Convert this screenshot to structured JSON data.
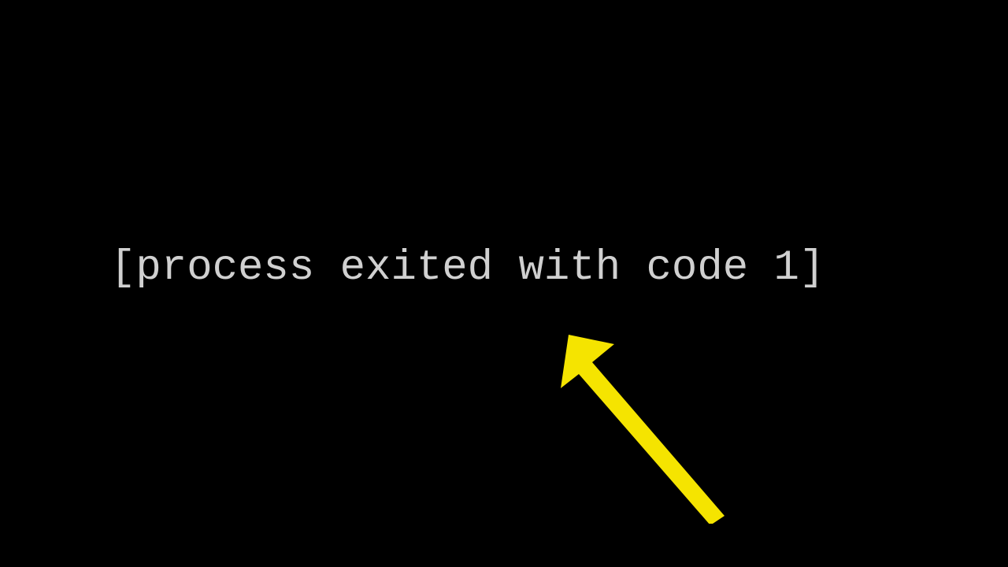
{
  "terminal": {
    "exit_message": "[process exited with code 1]"
  },
  "annotation": {
    "arrow_color": "#f5e400"
  }
}
